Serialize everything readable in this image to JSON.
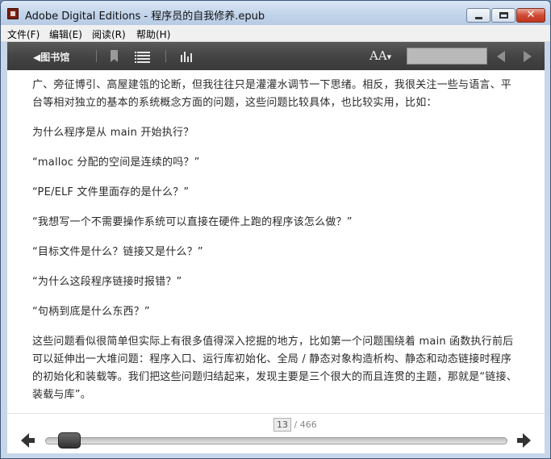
{
  "window": {
    "title": "Adobe Digital Editions - 程序员的自我修养.epub",
    "close_glyph": "✕"
  },
  "menu": {
    "items": [
      {
        "label": "文件(F)"
      },
      {
        "label": "编辑(E)"
      },
      {
        "label": "阅读(R)"
      },
      {
        "label": "帮助(H)"
      }
    ]
  },
  "toolbar": {
    "library_label": "◀图书馆",
    "font_size_label": "AA",
    "icons": [
      "bookmark-icon",
      "toc-icon",
      "stats-icon",
      "font-size-icon",
      "arrow-left-icon",
      "arrow-right-icon"
    ],
    "search_value": ""
  },
  "content": {
    "paragraphs": [
      "广、旁征博引、高屋建瓴的论断，但我往往只是灌灌水调节一下思绪。相反，我很关注一些与语言、平台等相对独立的基本的系统概念方面的问题，这些问题比较具体，也比较实用，比如：",
      "为什么程序是从 main 开始执行？",
      "“malloc 分配的空间是连续的吗？”",
      "“PE/ELF 文件里面存的是什么？”",
      "“我想写一个不需要操作系统可以直接在硬件上跑的程序该怎么做？”",
      "“目标文件是什么？链接又是什么？”",
      "“为什么这段程序链接时报错？”",
      "“句柄到底是什么东西？”",
      "这些问题看似很简单但实际上有很多值得深入挖掘的地方，比如第一个问题围绕着 main 函数执行前后可以延伸出一大堆问题：程序入口、运行库初始化、全局 / 静态对象构造析构、静态和动态链接时程序的初始化和装载等。我们把这些问题归结起来，发现主要是三个很大的而且连贯的主题，那就是“链接、装载与库”。"
    ]
  },
  "pagination": {
    "current_page": "13",
    "total_pages": "/ 466",
    "progress_fraction": 0.026
  },
  "colors": {
    "toolbar_bg": "#444444",
    "title_bar": "#c2d4ea",
    "close_button": "#cf4a34"
  }
}
